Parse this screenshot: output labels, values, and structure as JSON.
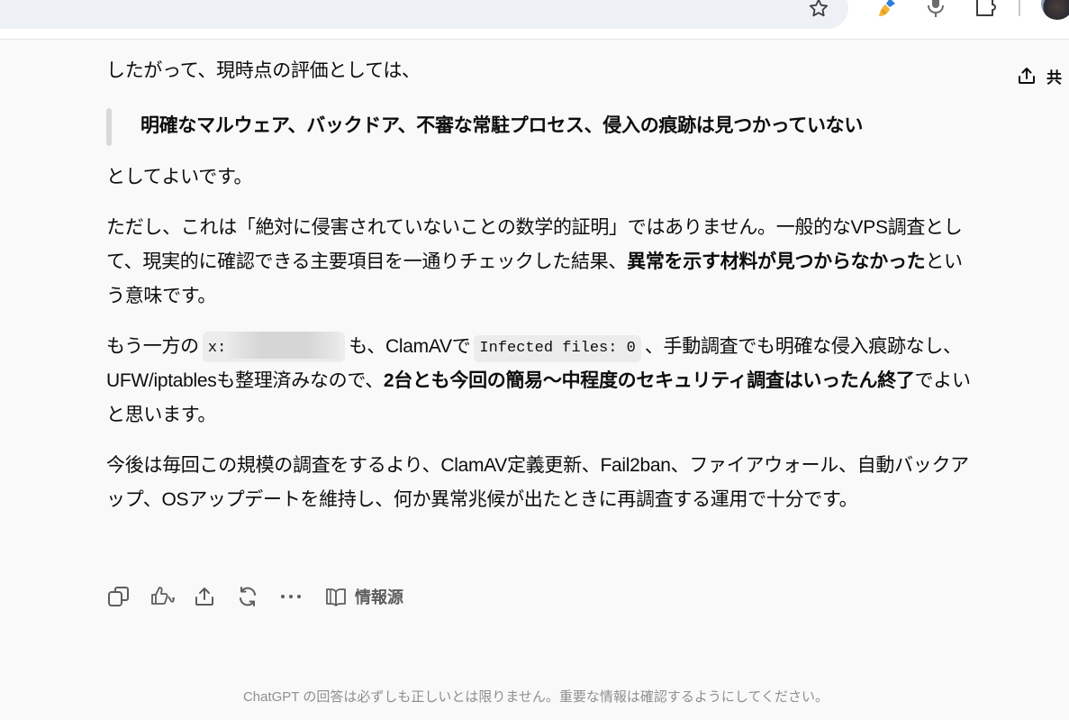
{
  "browser": {
    "url_fragment": "ee-bc96-50a42b19e207",
    "icons": [
      "star-icon",
      "brush-extension-icon",
      "microphone-icon",
      "puzzle-extension-icon",
      "profile-avatar"
    ]
  },
  "header": {
    "share_label": "共"
  },
  "message": {
    "p1": "したがって、現時点の評価としては、",
    "quote": "明確なマルウェア、バックドア、不審な常駐プロセス、侵入の痕跡は見つかっていない",
    "p2": "としてよいです。",
    "p3_a": "ただし、これは「絶対に侵害されていないことの数学的証明」ではありません。一般的なVPS調査として、現実的に確認できる主要項目を一通りチェックした結果、",
    "p3_b": "異常を示す材料が見つからなかった",
    "p3_c": "という意味です。",
    "p4_a": "もう一方の",
    "p4_code1": "x:",
    "p4_b": "も、ClamAVで",
    "p4_code2": "Infected files: 0",
    "p4_c": "、手動調査でも明確な侵入痕跡なし、UFW/iptablesも整理済みなので、",
    "p4_d": "2台とも今回の簡易〜中程度のセキュリティ調査はいったん終了",
    "p4_e": "でよいと思います。",
    "p5": "今後は毎回この規模の調査をするより、ClamAV定義更新、Fail2ban、ファイアウォール、自動バックアップ、OSアップデートを維持し、何か異常兆候が出たときに再調査する運用で十分です。"
  },
  "actions": {
    "sources_label": "情報源"
  },
  "footer": {
    "disclaimer": "ChatGPT の回答は必ずしも正しいとは限りません。重要な情報は確認するようにしてください。"
  },
  "colors": {
    "background": "#f9f9f9",
    "text": "#0d0d0d",
    "muted": "#8f8f8f",
    "code_bg": "#ececec"
  }
}
